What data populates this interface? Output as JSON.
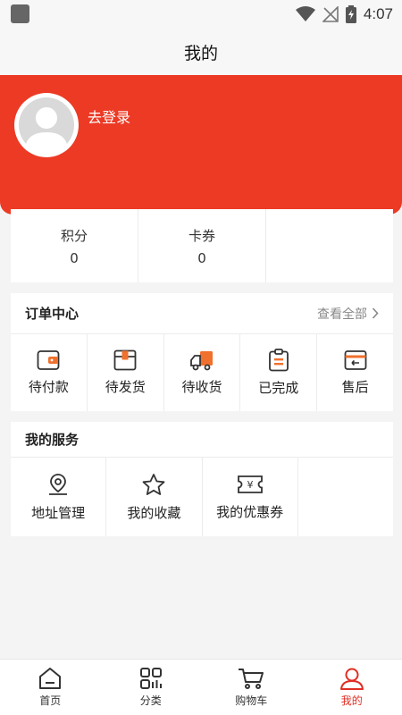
{
  "status_bar": {
    "time": "4:07"
  },
  "header": {
    "title": "我的"
  },
  "profile": {
    "login_label": "去登录"
  },
  "stats": [
    {
      "label": "积分",
      "value": "0"
    },
    {
      "label": "卡券",
      "value": "0"
    }
  ],
  "orders": {
    "title": "订单中心",
    "view_all": "查看全部",
    "items": [
      {
        "label": "待付款",
        "icon": "wallet-icon"
      },
      {
        "label": "待发货",
        "icon": "package-icon"
      },
      {
        "label": "待收货",
        "icon": "truck-icon"
      },
      {
        "label": "已完成",
        "icon": "clipboard-icon"
      },
      {
        "label": "售后",
        "icon": "card-return-icon"
      }
    ]
  },
  "services": {
    "title": "我的服务",
    "items": [
      {
        "label": "地址管理",
        "icon": "location-pin-icon"
      },
      {
        "label": "我的收藏",
        "icon": "star-icon"
      },
      {
        "label": "我的优惠券",
        "icon": "coupon-icon"
      }
    ]
  },
  "tabbar": {
    "items": [
      {
        "label": "首页",
        "icon": "home-icon"
      },
      {
        "label": "分类",
        "icon": "category-icon"
      },
      {
        "label": "购物车",
        "icon": "cart-icon"
      },
      {
        "label": "我的",
        "icon": "user-icon"
      }
    ],
    "active_index": 3
  },
  "colors": {
    "brand_red": "#ec3a25",
    "accent_orange": "#f0702e",
    "tab_active": "#e02e24"
  }
}
